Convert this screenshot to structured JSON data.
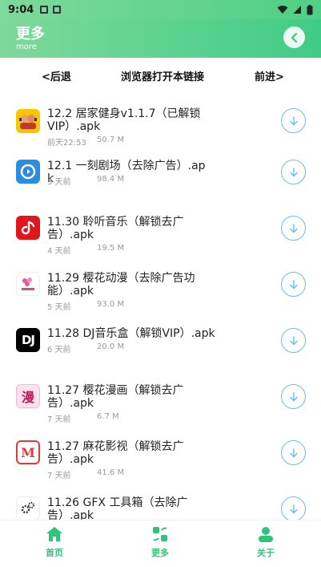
{
  "status_bar": {
    "time": "9:04"
  },
  "header": {
    "title": "更多",
    "subtitle": "more"
  },
  "browser_bar": {
    "back": "<后退",
    "open": "浏览器打开本链接",
    "forward": "前进>"
  },
  "items": [
    {
      "title": "12.2 居家健身v1.1.7（已解锁VIP）.apk",
      "time": "前天22:53",
      "size": "50.7 M",
      "icon": "fitness-app-icon"
    },
    {
      "title": "12.1 一刻剧场（去除广告）.apk",
      "time": "3 天前",
      "size": "98.4 M",
      "icon": "theater-app-icon"
    },
    {
      "title": "11.30 聆听音乐（解锁去广告）.apk",
      "time": "4 天前",
      "size": "19.5 M",
      "icon": "music-app-icon"
    },
    {
      "title": "11.29 樱花动漫（去除广告功能）.apk",
      "time": "5 天前",
      "size": "93.0 M",
      "icon": "anime-app-icon"
    },
    {
      "title": "11.28 DJ音乐盒（解锁VIP）.apk",
      "time": "6 天前",
      "size": "20.0 M",
      "icon": "dj-app-icon",
      "icon_text": "DJ"
    },
    {
      "title": "11.27 樱花漫画（解锁去广告）.apk",
      "time": "7 天前",
      "size": "6.7 M",
      "icon": "comic-app-icon",
      "icon_text": "漫"
    },
    {
      "title": "11.27 麻花影视（解锁去广告）.apk",
      "time": "7 天前",
      "size": "41.6 M",
      "icon": "video-app-icon",
      "icon_text": "M"
    },
    {
      "title": "11.26 GFX 工具箱（去除广告）.apk",
      "time": "",
      "size": "",
      "icon": "gfx-tool-app-icon"
    }
  ],
  "bottom_nav": {
    "home": "首页",
    "more": "更多",
    "about": "关于"
  },
  "colors": {
    "accent": "#2ec57a",
    "header_start": "#7ed99b",
    "header_end": "#40cc86",
    "download": "#64bdf3"
  }
}
